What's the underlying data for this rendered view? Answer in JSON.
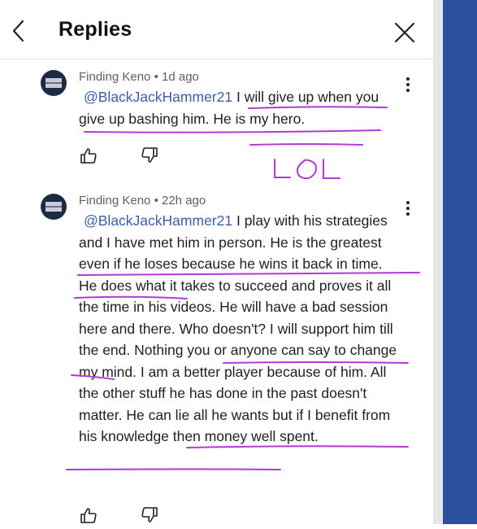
{
  "header": {
    "title": "Replies",
    "back_icon": "chevron-left-icon",
    "close_icon": "close-icon"
  },
  "replies": [
    {
      "author": "Finding Keno",
      "time": "• 1d ago",
      "mention": "@BlackJackHammer21",
      "text": "I will give up when you give up bashing him. He is my hero."
    },
    {
      "author": "Finding Keno",
      "time": "• 22h ago",
      "mention": "@BlackJackHammer21",
      "text": "I play with his strategies and I have met him in person. He is the greatest even if he loses because he wins it back in time. He does what it takes to succeed and proves it all the time in his videos. He will have a bad session here and there. Who doesn't? I will support him till the end. Nothing you or anyone can say to change my mind. I am a better player because of him. All the other stuff he has done in the past doesn't matter. He can lie all he wants but if I benefit from his knowledge then money well spent."
    }
  ],
  "annotation": {
    "handwritten_note": "LOL",
    "color": "#b23ad6"
  },
  "colors": {
    "accent_blue": "#2c4f9e",
    "mention": "#3b5fa8",
    "meta": "#606060"
  }
}
